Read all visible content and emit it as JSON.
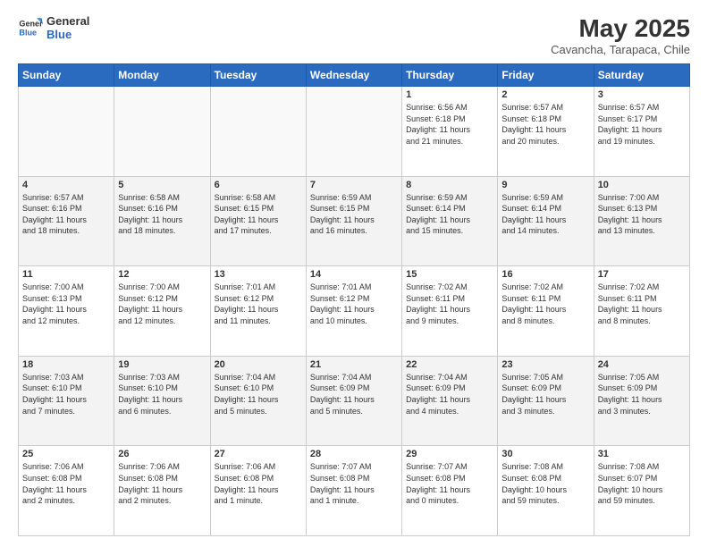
{
  "logo": {
    "line1": "General",
    "line2": "Blue"
  },
  "title": "May 2025",
  "subtitle": "Cavancha, Tarapaca, Chile",
  "weekdays": [
    "Sunday",
    "Monday",
    "Tuesday",
    "Wednesday",
    "Thursday",
    "Friday",
    "Saturday"
  ],
  "weeks": [
    [
      {
        "day": "",
        "info": "",
        "empty": true
      },
      {
        "day": "",
        "info": "",
        "empty": true
      },
      {
        "day": "",
        "info": "",
        "empty": true
      },
      {
        "day": "",
        "info": "",
        "empty": true
      },
      {
        "day": "1",
        "info": "Sunrise: 6:56 AM\nSunset: 6:18 PM\nDaylight: 11 hours\nand 21 minutes."
      },
      {
        "day": "2",
        "info": "Sunrise: 6:57 AM\nSunset: 6:18 PM\nDaylight: 11 hours\nand 20 minutes."
      },
      {
        "day": "3",
        "info": "Sunrise: 6:57 AM\nSunset: 6:17 PM\nDaylight: 11 hours\nand 19 minutes."
      }
    ],
    [
      {
        "day": "4",
        "info": "Sunrise: 6:57 AM\nSunset: 6:16 PM\nDaylight: 11 hours\nand 18 minutes."
      },
      {
        "day": "5",
        "info": "Sunrise: 6:58 AM\nSunset: 6:16 PM\nDaylight: 11 hours\nand 18 minutes."
      },
      {
        "day": "6",
        "info": "Sunrise: 6:58 AM\nSunset: 6:15 PM\nDaylight: 11 hours\nand 17 minutes."
      },
      {
        "day": "7",
        "info": "Sunrise: 6:59 AM\nSunset: 6:15 PM\nDaylight: 11 hours\nand 16 minutes."
      },
      {
        "day": "8",
        "info": "Sunrise: 6:59 AM\nSunset: 6:14 PM\nDaylight: 11 hours\nand 15 minutes."
      },
      {
        "day": "9",
        "info": "Sunrise: 6:59 AM\nSunset: 6:14 PM\nDaylight: 11 hours\nand 14 minutes."
      },
      {
        "day": "10",
        "info": "Sunrise: 7:00 AM\nSunset: 6:13 PM\nDaylight: 11 hours\nand 13 minutes."
      }
    ],
    [
      {
        "day": "11",
        "info": "Sunrise: 7:00 AM\nSunset: 6:13 PM\nDaylight: 11 hours\nand 12 minutes."
      },
      {
        "day": "12",
        "info": "Sunrise: 7:00 AM\nSunset: 6:12 PM\nDaylight: 11 hours\nand 12 minutes."
      },
      {
        "day": "13",
        "info": "Sunrise: 7:01 AM\nSunset: 6:12 PM\nDaylight: 11 hours\nand 11 minutes."
      },
      {
        "day": "14",
        "info": "Sunrise: 7:01 AM\nSunset: 6:12 PM\nDaylight: 11 hours\nand 10 minutes."
      },
      {
        "day": "15",
        "info": "Sunrise: 7:02 AM\nSunset: 6:11 PM\nDaylight: 11 hours\nand 9 minutes."
      },
      {
        "day": "16",
        "info": "Sunrise: 7:02 AM\nSunset: 6:11 PM\nDaylight: 11 hours\nand 8 minutes."
      },
      {
        "day": "17",
        "info": "Sunrise: 7:02 AM\nSunset: 6:11 PM\nDaylight: 11 hours\nand 8 minutes."
      }
    ],
    [
      {
        "day": "18",
        "info": "Sunrise: 7:03 AM\nSunset: 6:10 PM\nDaylight: 11 hours\nand 7 minutes."
      },
      {
        "day": "19",
        "info": "Sunrise: 7:03 AM\nSunset: 6:10 PM\nDaylight: 11 hours\nand 6 minutes."
      },
      {
        "day": "20",
        "info": "Sunrise: 7:04 AM\nSunset: 6:10 PM\nDaylight: 11 hours\nand 5 minutes."
      },
      {
        "day": "21",
        "info": "Sunrise: 7:04 AM\nSunset: 6:09 PM\nDaylight: 11 hours\nand 5 minutes."
      },
      {
        "day": "22",
        "info": "Sunrise: 7:04 AM\nSunset: 6:09 PM\nDaylight: 11 hours\nand 4 minutes."
      },
      {
        "day": "23",
        "info": "Sunrise: 7:05 AM\nSunset: 6:09 PM\nDaylight: 11 hours\nand 3 minutes."
      },
      {
        "day": "24",
        "info": "Sunrise: 7:05 AM\nSunset: 6:09 PM\nDaylight: 11 hours\nand 3 minutes."
      }
    ],
    [
      {
        "day": "25",
        "info": "Sunrise: 7:06 AM\nSunset: 6:08 PM\nDaylight: 11 hours\nand 2 minutes."
      },
      {
        "day": "26",
        "info": "Sunrise: 7:06 AM\nSunset: 6:08 PM\nDaylight: 11 hours\nand 2 minutes."
      },
      {
        "day": "27",
        "info": "Sunrise: 7:06 AM\nSunset: 6:08 PM\nDaylight: 11 hours\nand 1 minute."
      },
      {
        "day": "28",
        "info": "Sunrise: 7:07 AM\nSunset: 6:08 PM\nDaylight: 11 hours\nand 1 minute."
      },
      {
        "day": "29",
        "info": "Sunrise: 7:07 AM\nSunset: 6:08 PM\nDaylight: 11 hours\nand 0 minutes."
      },
      {
        "day": "30",
        "info": "Sunrise: 7:08 AM\nSunset: 6:08 PM\nDaylight: 10 hours\nand 59 minutes."
      },
      {
        "day": "31",
        "info": "Sunrise: 7:08 AM\nSunset: 6:07 PM\nDaylight: 10 hours\nand 59 minutes."
      }
    ]
  ]
}
